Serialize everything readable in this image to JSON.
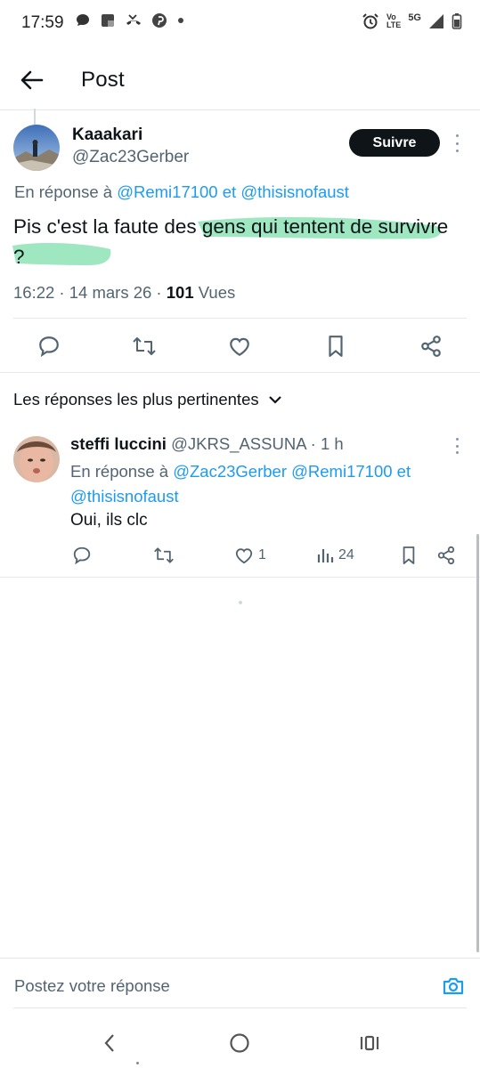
{
  "status_bar": {
    "time": "17:59",
    "icons_left": [
      "message-icon",
      "screen-icon",
      "missed-call-icon",
      "pinterest-icon",
      "dot-icon"
    ],
    "icons_right": [
      "alarm-icon",
      "volte-icon",
      "5g-icon",
      "signal-icon",
      "battery-icon"
    ],
    "network_5g": "5G",
    "volte_top": "Vo",
    "volte_bottom": "LTE"
  },
  "header": {
    "title": "Post"
  },
  "main_post": {
    "name": "Kaaakari",
    "handle": "@Zac23Gerber",
    "follow_label": "Suivre",
    "reply_prefix": "En réponse à",
    "reply_user1": "@Remi17100",
    "reply_conj": "et",
    "reply_user2": "@thisisnofaust",
    "text": "Pis c'est la faute des gens qui tentent de survivre ?",
    "time": "16:22",
    "date": "14 mars 26",
    "views_count": "101",
    "views_label": "Vues",
    "highlight_color": "#8ee3b6"
  },
  "sort": {
    "label": "Les réponses les plus pertinentes"
  },
  "reply_post": {
    "name": "steffi luccini",
    "handle": "@JKRS_ASSUNA",
    "age": "1 h",
    "reply_prefix": "En réponse à",
    "reply_user1": "@Zac23Gerber",
    "reply_user2": "@Remi17100",
    "reply_conj": "et",
    "reply_user3": "@thisisnofaust",
    "text": "Oui, ils clc",
    "likes": "1",
    "views": "24"
  },
  "compose": {
    "placeholder": "Postez votre réponse"
  },
  "colors": {
    "accent": "#1d9bf0",
    "text": "#0f1419",
    "muted": "#536471"
  }
}
